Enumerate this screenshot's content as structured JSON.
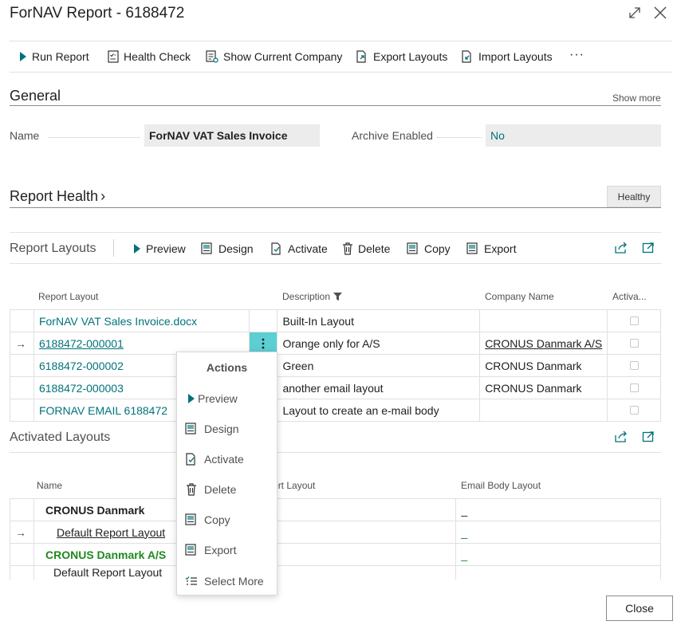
{
  "window": {
    "title": "ForNAV Report - 6188472"
  },
  "actions": {
    "run_report": "Run Report",
    "health_check": "Health Check",
    "show_company": "Show Current Company",
    "export_layouts": "Export Layouts",
    "import_layouts": "Import Layouts",
    "more": "···"
  },
  "general": {
    "title": "General",
    "show_more": "Show more",
    "name_label": "Name",
    "name_value": "ForNAV VAT Sales Invoice",
    "archive_label": "Archive Enabled",
    "archive_value": "No"
  },
  "health": {
    "title": "Report Health",
    "chevron": "›",
    "status": "Healthy"
  },
  "layouts": {
    "title": "Report Layouts",
    "actions": {
      "preview": "Preview",
      "design": "Design",
      "activate": "Activate",
      "delete": "Delete",
      "copy": "Copy",
      "export": "Export"
    },
    "columns": {
      "layout": "Report Layout",
      "description": "Description",
      "company": "Company Name",
      "active": "Activa..."
    },
    "rows": [
      {
        "arrow": "",
        "layout": "ForNAV VAT Sales Invoice.docx",
        "description": "Built-In Layout",
        "company": ""
      },
      {
        "arrow": "→",
        "layout": "6188472-000001",
        "description": "Orange only for A/S",
        "company": "CRONUS Danmark A/S"
      },
      {
        "arrow": "",
        "layout": "6188472-000002",
        "description": "Green",
        "company": "CRONUS Danmark"
      },
      {
        "arrow": "",
        "layout": "6188472-000003",
        "description": "another email layout",
        "company": "CRONUS Danmark"
      },
      {
        "arrow": "",
        "layout": "FORNAV EMAIL 6188472",
        "description": "Layout to create an e-mail body",
        "company": ""
      }
    ]
  },
  "activated": {
    "title": "Activated Layouts",
    "columns": {
      "name": "Name",
      "layout": "Report Layout",
      "email": "Email Body Layout"
    },
    "rows": [
      {
        "arrow": "",
        "name": "CRONUS Danmark",
        "email": "_"
      },
      {
        "arrow": "→",
        "name": "Default Report Layout",
        "email": "_"
      },
      {
        "arrow": "",
        "name": "CRONUS Danmark A/S",
        "email": "_"
      },
      {
        "arrow": "",
        "name": "Default Report Layout",
        "email": ""
      }
    ]
  },
  "context_menu": {
    "title": "Actions",
    "items": [
      "Preview",
      "Design",
      "Activate",
      "Delete",
      "Copy",
      "Export",
      "Select More"
    ]
  },
  "footer": {
    "close": "Close"
  },
  "colors": {
    "accent": "#00737a",
    "highlight": "#5ccfd3",
    "green": "#1e8a1e"
  }
}
